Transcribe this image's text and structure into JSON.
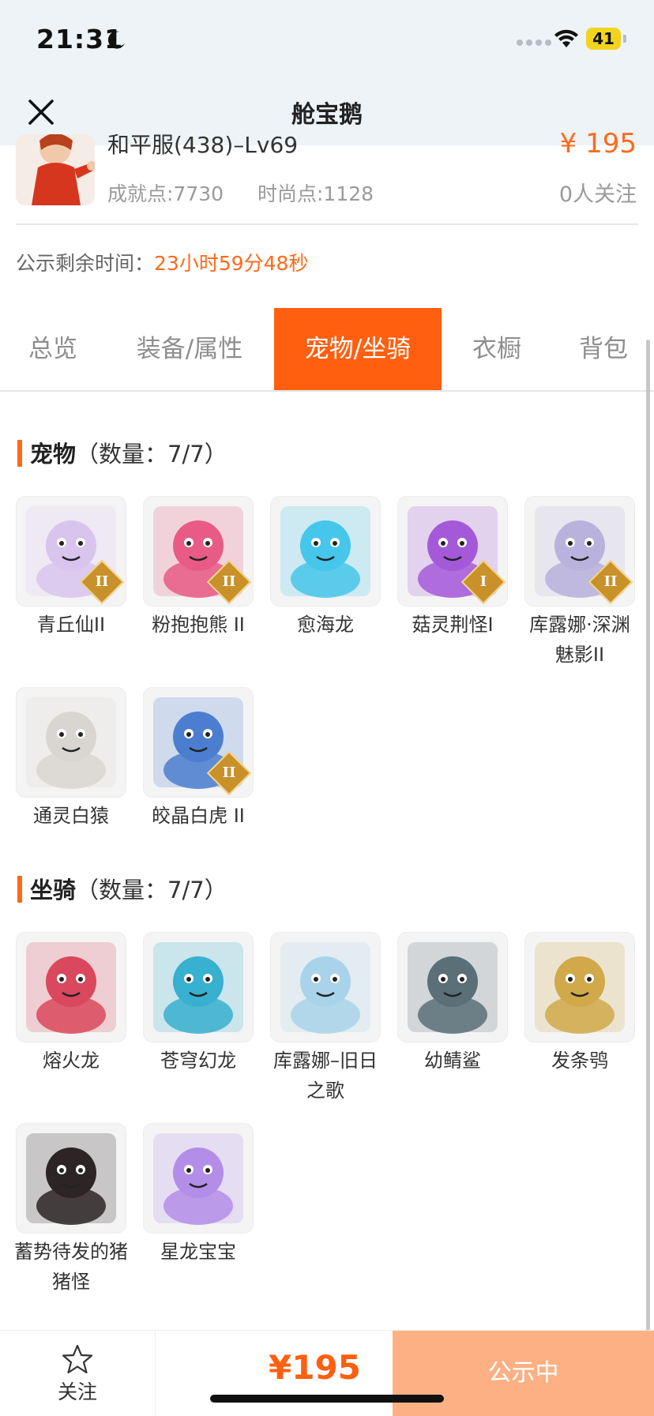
{
  "status_bar": {
    "time": "21:31",
    "battery": "41"
  },
  "nav": {
    "title": "舱宝鹅"
  },
  "product": {
    "name": "和平服(438)–Lv69",
    "price": "¥ 195",
    "achievement": "成就点:7730",
    "fashion": "时尚点:1128",
    "followers": "0人关注"
  },
  "timer": {
    "label": "公示剩余时间：",
    "value": "23小时59分48秒"
  },
  "tabs": [
    {
      "label": "总览"
    },
    {
      "label": "装备/属性"
    },
    {
      "label": "宠物/坐骑"
    },
    {
      "label": "衣橱"
    },
    {
      "label": "背包"
    }
  ],
  "pets": {
    "title": "宠物",
    "count": "（数量：7/7）",
    "items": [
      {
        "name": "青丘仙II",
        "tier": "II",
        "icon": "fox-fairy-icon",
        "color": "#d9c4ee"
      },
      {
        "name": "粉抱抱熊 II",
        "tier": "II",
        "icon": "pink-bear-icon",
        "color": "#e85b86"
      },
      {
        "name": "愈海龙",
        "icon": "sea-dragon-icon",
        "color": "#46c6ea"
      },
      {
        "name": "菇灵荆怪I",
        "tier": "I",
        "icon": "mushroom-sprite-icon",
        "color": "#a45ad8"
      },
      {
        "name": "库露娜·深渊魅影II",
        "tier": "II",
        "icon": "abyss-phantom-icon",
        "color": "#b9b2dc"
      },
      {
        "name": "通灵白猿",
        "icon": "white-ape-icon",
        "color": "#d9d6d2"
      },
      {
        "name": "皎晶白虎 II",
        "tier": "II",
        "icon": "white-tiger-icon",
        "color": "#4c7ed0"
      }
    ]
  },
  "mounts": {
    "title": "坐骑",
    "count": "（数量：7/7）",
    "items": [
      {
        "name": "熔火龙",
        "icon": "lava-dragon-icon",
        "color": "#d9485c"
      },
      {
        "name": "苍穹幻龙",
        "icon": "sky-dragon-icon",
        "color": "#38b0cf"
      },
      {
        "name": "库露娜–旧日之歌",
        "icon": "song-of-yesterday-icon",
        "color": "#a9d3ea"
      },
      {
        "name": "幼鲭鲨",
        "icon": "baby-shark-icon",
        "color": "#5a6f78"
      },
      {
        "name": "发条鸮",
        "icon": "clockwork-owl-icon",
        "color": "#d1a94a"
      },
      {
        "name": "蓄势待发的猪猪怪",
        "icon": "pig-monster-icon",
        "color": "#2d2426"
      },
      {
        "name": "星龙宝宝",
        "icon": "baby-star-dragon-icon",
        "color": "#b38ee8"
      }
    ]
  },
  "footer": {
    "follow": "关注",
    "price": "¥195",
    "status": "公示中"
  }
}
